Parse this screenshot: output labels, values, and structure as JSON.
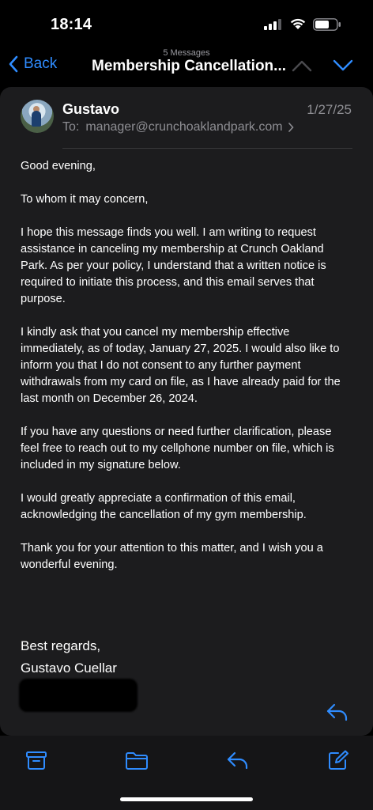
{
  "status_bar": {
    "time": "18:14"
  },
  "nav": {
    "back_label": "Back",
    "message_count": "5 Messages",
    "title": "Membership Cancellation..."
  },
  "email": {
    "sender": "Gustavo",
    "date": "1/27/25",
    "to_label": "To:",
    "to_address": "manager@crunchoaklandpark.com",
    "paragraphs": [
      "Good evening,",
      "To whom it may concern,",
      "I hope this message finds you well. I am writing to request assistance in canceling my membership at Crunch Oakland Park. As per your policy, I understand that a written notice is required to initiate this process, and this email serves that purpose.",
      "I kindly ask that you cancel my membership effective immediately, as of today, January 27, 2025. I would also like to inform you that I do not consent to any further payment withdrawals from my card on file, as I have already paid for the last month on December 26, 2024.",
      "If you have any questions or need further clarification, please feel free to reach out to my cellphone number on file, which is included in my signature below.",
      "I would greatly appreciate a confirmation of this email, acknowledging the cancellation of my gym membership.",
      "Thank you for your attention to this matter, and I wish you a wonderful evening."
    ],
    "closing_line1": "Best regards,",
    "closing_line2": "Gustavo Cuellar"
  },
  "toolbar": {
    "items": [
      "archive-icon",
      "folder-icon",
      "reply-icon",
      "compose-icon"
    ]
  },
  "colors": {
    "accent": "#2f8cff",
    "card": "#1c1c1e",
    "secondary_text": "#8e8e93"
  }
}
